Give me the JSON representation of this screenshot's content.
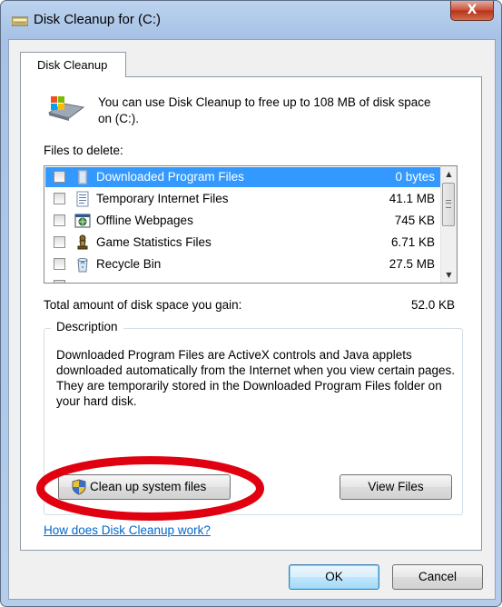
{
  "window": {
    "title": "Disk Cleanup for  (C:)",
    "close_glyph": "X"
  },
  "tab": {
    "label": "Disk Cleanup"
  },
  "intro": {
    "icon": "disk-cleanup-icon",
    "text": "You can use Disk Cleanup to free up to 108 MB of disk space on  (C:)."
  },
  "files": {
    "label": "Files to delete:",
    "rows": [
      {
        "name": "Downloaded Program Files",
        "size": "0 bytes",
        "checked": false,
        "selected": true,
        "icon": "folder-icon"
      },
      {
        "name": "Temporary Internet Files",
        "size": "41.1 MB",
        "checked": false,
        "selected": false,
        "icon": "document-icon"
      },
      {
        "name": "Offline Webpages",
        "size": "745 KB",
        "checked": false,
        "selected": false,
        "icon": "offline-webpage-icon"
      },
      {
        "name": "Game Statistics Files",
        "size": "6.71 KB",
        "checked": false,
        "selected": false,
        "icon": "chess-piece-icon"
      },
      {
        "name": "Recycle Bin",
        "size": "27.5 MB",
        "checked": false,
        "selected": false,
        "icon": "recycle-bin-icon"
      }
    ]
  },
  "total": {
    "label": "Total amount of disk space you gain:",
    "value": "52.0 KB"
  },
  "description": {
    "title": "Description",
    "text": "Downloaded Program Files are ActiveX controls and Java applets downloaded automatically from the Internet when you view certain pages. They are temporarily stored in the Downloaded Program Files folder on your hard disk."
  },
  "buttons": {
    "cleanup_system": "Clean up system files",
    "view_files": "View Files",
    "ok": "OK",
    "cancel": "Cancel"
  },
  "help_link": "How does Disk Cleanup work?",
  "colors": {
    "selection": "#3399ff",
    "link": "#0066cc",
    "annotation_red": "#e0000f"
  }
}
